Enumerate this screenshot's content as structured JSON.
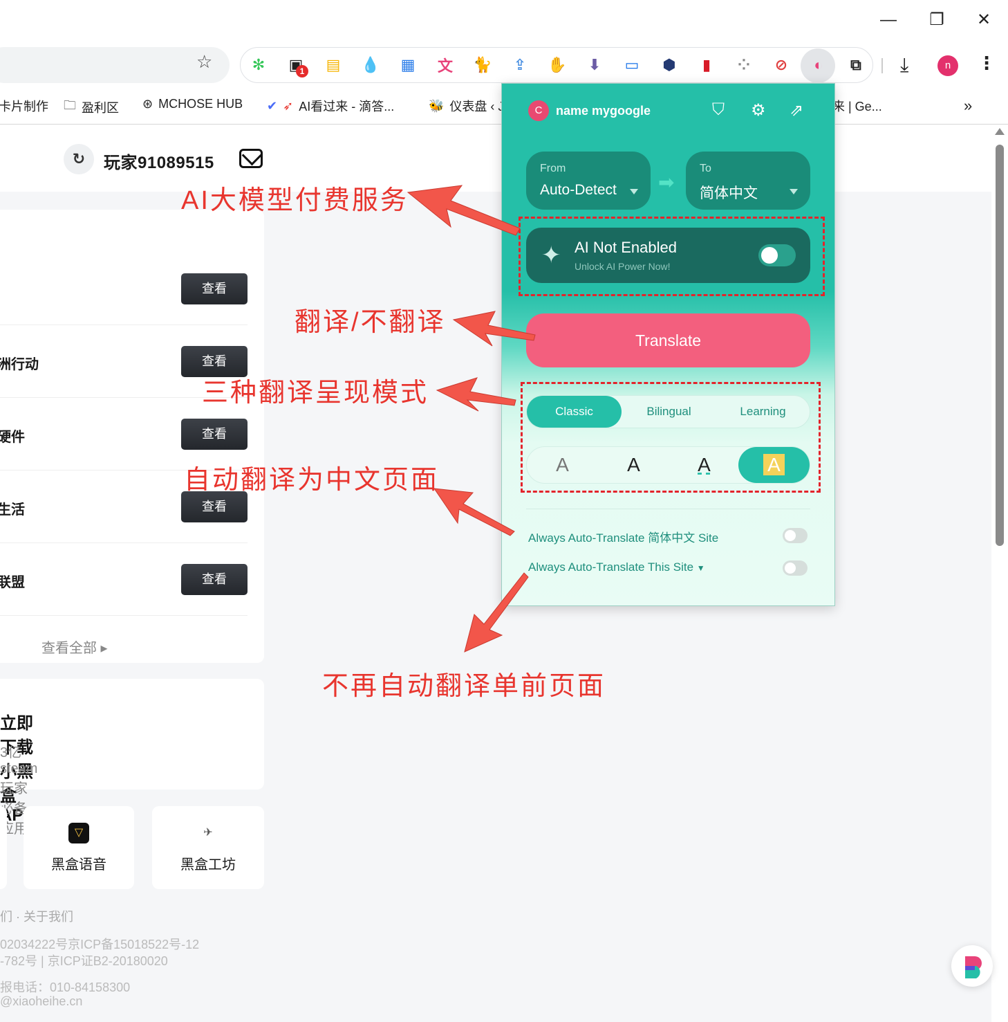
{
  "window": {
    "minimize": "—",
    "restore": "❐",
    "close": "✕"
  },
  "toolbar": {
    "star": "☆",
    "downloads_icon": "download-icon",
    "profile_initial": "n",
    "menu": "⋮",
    "extensions": [
      {
        "name": "lime-ext-icon",
        "glyph": "✻",
        "color": "#35c759"
      },
      {
        "name": "chat-ext-icon",
        "glyph": "▣",
        "color": "#222222",
        "badge": "1"
      },
      {
        "name": "folder-ext-icon",
        "glyph": "▤",
        "color": "#f6b400"
      },
      {
        "name": "drop-ext-icon",
        "glyph": "💧",
        "color": "#1a73e8"
      },
      {
        "name": "doc-ext-icon",
        "glyph": "▦",
        "color": "#2b7de9"
      },
      {
        "name": "translate-ext-icon",
        "glyph": "文",
        "color": "#e8437a"
      },
      {
        "name": "cat-ext-icon",
        "glyph": "🐈",
        "color": "#f0b400"
      },
      {
        "name": "upload-ext-icon",
        "glyph": "⇪",
        "color": "#4a90e2"
      },
      {
        "name": "adblock-ext-icon",
        "glyph": "✋",
        "color": "#e02020"
      },
      {
        "name": "archive-ext-icon",
        "glyph": "⬇",
        "color": "#6b5ca5"
      },
      {
        "name": "screen-ext-icon",
        "glyph": "▭",
        "color": "#1a73e8"
      },
      {
        "name": "cube-ext-icon",
        "glyph": "⬢",
        "color": "#243a73"
      },
      {
        "name": "bookmark-ext-icon",
        "glyph": "▮",
        "color": "#d81b28"
      },
      {
        "name": "grid-ext-icon",
        "glyph": "⁘",
        "color": "#888888"
      },
      {
        "name": "cursor-ext-icon",
        "glyph": "⊘",
        "color": "#e04040"
      },
      {
        "name": "immersive-translate-ext-icon",
        "glyph": "◐",
        "color": "#e8437a"
      },
      {
        "name": "puzzle-ext-icon",
        "glyph": "⧉",
        "color": "#222222"
      }
    ]
  },
  "bookmarks": [
    {
      "label": "卡片制作",
      "icon": ""
    },
    {
      "label": "盈利区",
      "icon": "🗀"
    },
    {
      "label": "MCHOSE HUB",
      "icon": "⊛"
    },
    {
      "label": "AI看过来 - 滴答...",
      "icon": "✔"
    },
    {
      "label": "仪表盘 ‹ J",
      "icon": "🐝"
    },
    {
      "label": "来 | Ge...",
      "icon": ""
    }
  ],
  "bookmarks_more": "»",
  "page": {
    "user_name": "玩家91089515",
    "rows": [
      {
        "title": "",
        "button": "查看"
      },
      {
        "title": "洲行动",
        "button": "查看"
      },
      {
        "title": "硬件",
        "button": "查看"
      },
      {
        "title": "生活",
        "button": "查看"
      },
      {
        "title": "联盟",
        "button": "查看"
      }
    ],
    "view_all": "查看全部 ▸",
    "app_title": "立即下载小黑盒APP",
    "app_sub": "3亿steam玩家必备应用",
    "tiles": [
      {
        "label": "黑盒语音"
      },
      {
        "label": "黑盒工坊"
      }
    ],
    "footer": [
      "们 · 关于我们",
      "02034222号京ICP备15018522号-12",
      "-782号 | 京ICP证B2-20180020",
      "报电话：010-84158300",
      "@xiaoheihe.cn"
    ]
  },
  "popup": {
    "avatar_initial": "C",
    "user": "name mygoogle",
    "from_label": "From",
    "from_value": "Auto-Detect",
    "to_label": "To",
    "to_value": "简体中文",
    "ai_title": "AI Not Enabled",
    "ai_sub": "Unlock AI Power Now!",
    "translate_button": "Translate",
    "modes": [
      "Classic",
      "Bilingual",
      "Learning"
    ],
    "active_mode": "Classic",
    "styles": [
      "A",
      "A",
      "A",
      "A"
    ],
    "auto_translate_lang": "Always Auto-Translate 简体中文 Site",
    "auto_translate_site": "Always Auto-Translate This Site",
    "accent": "#25bfa8",
    "button_color": "#f35f7e"
  },
  "annotations": {
    "ai_service": "AI大模型付费服务",
    "toggle_translate": "翻译/不翻译",
    "three_modes": "三种翻译呈现模式",
    "auto_chinese": "自动翻译为中文页面",
    "no_auto_this": "不再自动翻译单前页面",
    "color": "#e8352e"
  }
}
